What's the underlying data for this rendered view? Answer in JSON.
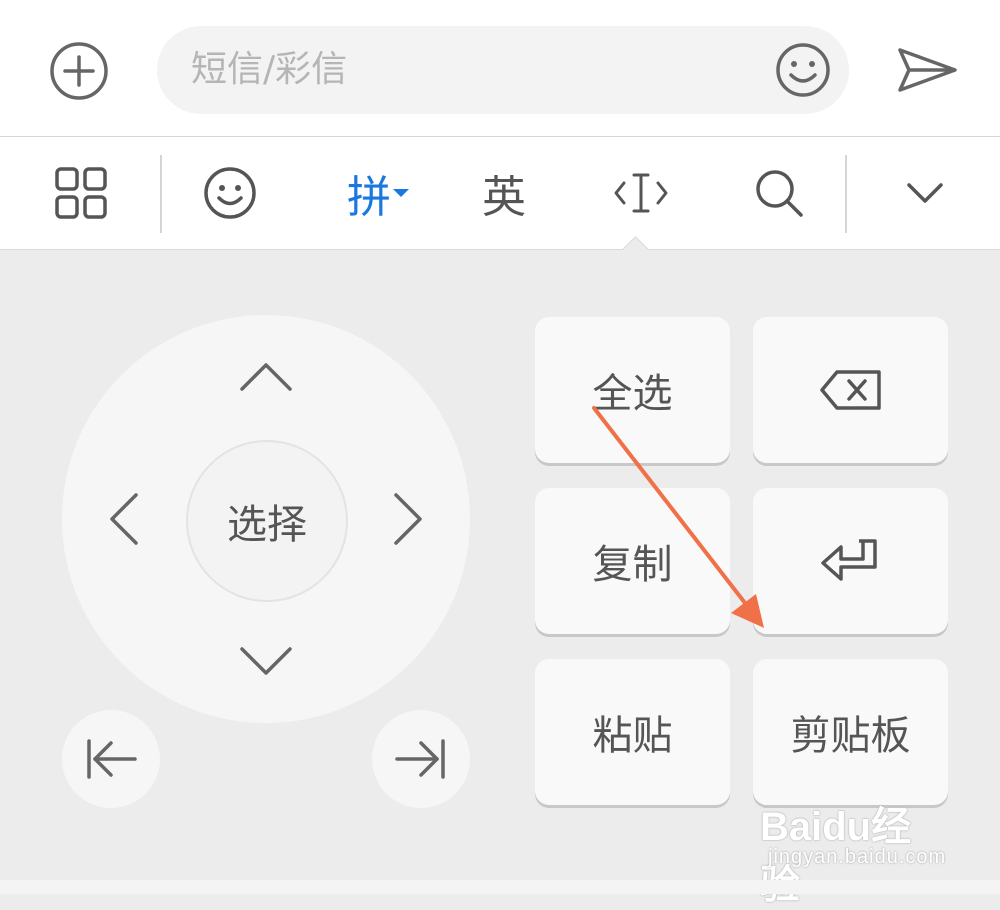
{
  "message_bar": {
    "input_placeholder": "短信/彩信",
    "icons": {
      "add": "plus-circle-icon",
      "emoji": "smiley-icon",
      "send": "send-icon"
    }
  },
  "toolbar": {
    "items": [
      {
        "icon": "grid-menu-icon"
      },
      {
        "icon": "smiley-icon"
      },
      {
        "label": "拼",
        "active": true,
        "accent": "#1a78e0"
      },
      {
        "label": "英"
      },
      {
        "icon": "text-cursor-icon"
      },
      {
        "icon": "search-icon"
      },
      {
        "icon": "chevron-down-icon"
      }
    ]
  },
  "dpad": {
    "center_label": "选择",
    "arrows": [
      "up-arrow-icon",
      "left-arrow-icon",
      "right-arrow-icon",
      "down-arrow-icon"
    ],
    "start_button_icon": "jump-to-start-icon",
    "end_button_icon": "jump-to-end-icon"
  },
  "keys": {
    "select_all": "全选",
    "backspace_icon": "backspace-icon",
    "copy": "复制",
    "enter_icon": "enter-icon",
    "paste": "粘贴",
    "clipboard": "剪贴板"
  },
  "annotation": {
    "color": "#f07048"
  },
  "watermark": {
    "line1": "Baidu经验",
    "line2": "jingyan.baidu.com"
  }
}
